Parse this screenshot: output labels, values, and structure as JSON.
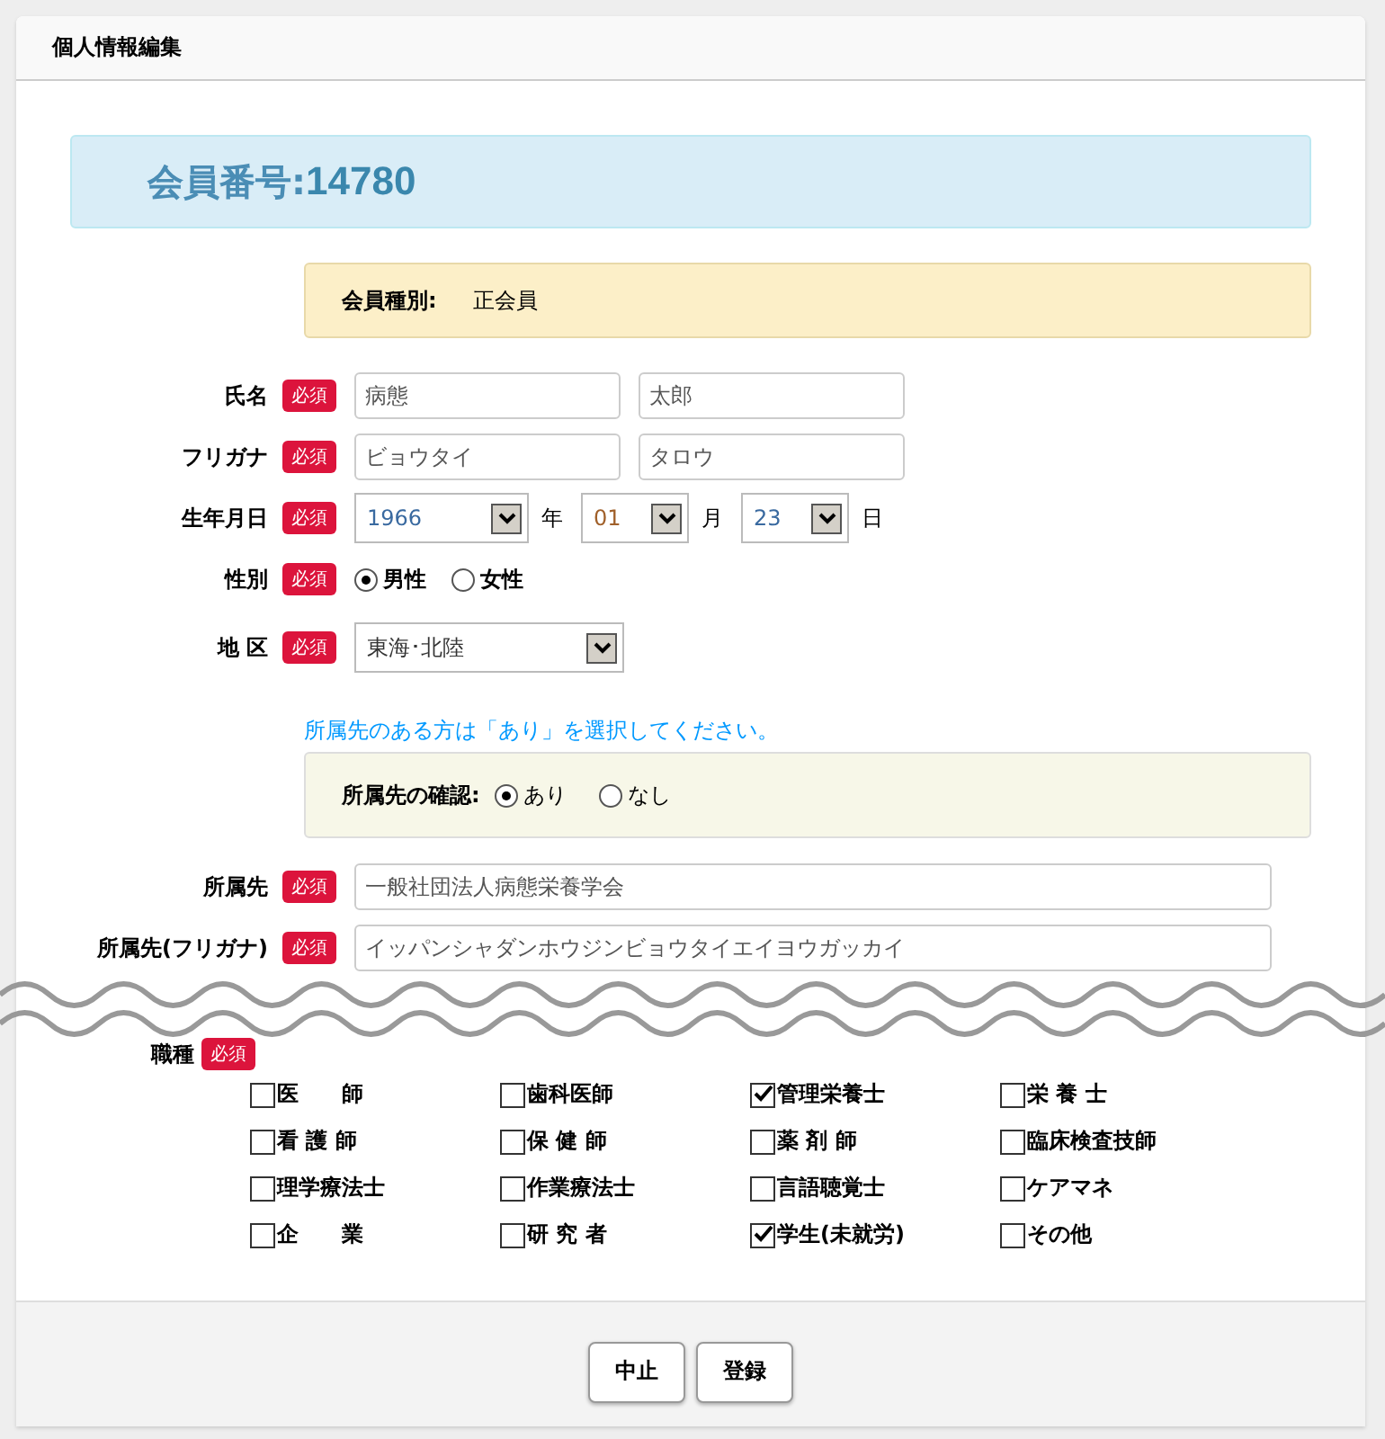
{
  "window": {
    "title": "個人情報編集"
  },
  "member": {
    "label": "会員番号:",
    "number": "14780"
  },
  "member_type": {
    "label": "会員種別:",
    "value": "正会員"
  },
  "name": {
    "label": "氏名",
    "badge": "必須",
    "last": "病態",
    "first": "太郎"
  },
  "kana": {
    "label": "フリガナ",
    "badge": "必須",
    "last": "ビョウタイ",
    "first": "タロウ"
  },
  "birth": {
    "label": "生年月日",
    "badge": "必須",
    "year": "1966",
    "year_unit": "年",
    "month": "01",
    "month_unit": "月",
    "day": "23",
    "day_unit": "日"
  },
  "gender": {
    "label": "性別",
    "badge": "必須",
    "options": [
      {
        "label": "男性",
        "selected": true
      },
      {
        "label": "女性",
        "selected": false
      }
    ]
  },
  "region": {
    "label": "地 区",
    "badge": "必須",
    "value": "東海･北陸"
  },
  "affiliation_note": "所属先のある方は「あり」を選択してください。",
  "affiliation_check": {
    "label": "所属先の確認:",
    "options": [
      {
        "label": "あり",
        "selected": true
      },
      {
        "label": "なし",
        "selected": false
      }
    ]
  },
  "affiliation": {
    "label": "所属先",
    "badge": "必須",
    "value": "一般社団法人病態栄養学会"
  },
  "affiliation_kana": {
    "label": "所属先(フリガナ)",
    "badge": "必須",
    "value": "イッパンシャダンホウジンビョウタイエイヨウガッカイ"
  },
  "occupation": {
    "label": "職種",
    "badge": "必須",
    "options": [
      {
        "label": "医　　師",
        "checked": false
      },
      {
        "label": "歯科医師",
        "checked": false
      },
      {
        "label": "管理栄養士",
        "checked": true
      },
      {
        "label": "栄 養 士",
        "checked": false
      },
      {
        "label": "看 護 師",
        "checked": false
      },
      {
        "label": "保 健 師",
        "checked": false
      },
      {
        "label": "薬 剤 師",
        "checked": false
      },
      {
        "label": "臨床検査技師",
        "checked": false
      },
      {
        "label": "理学療法士",
        "checked": false
      },
      {
        "label": "作業療法士",
        "checked": false
      },
      {
        "label": "言語聴覚士",
        "checked": false
      },
      {
        "label": "ケアマネ",
        "checked": false
      },
      {
        "label": "企　　業",
        "checked": false
      },
      {
        "label": "研 究 者",
        "checked": false
      },
      {
        "label": "学生(未就労)",
        "checked": true
      },
      {
        "label": "その他",
        "checked": false
      }
    ]
  },
  "buttons": [
    "中止",
    "登録"
  ]
}
